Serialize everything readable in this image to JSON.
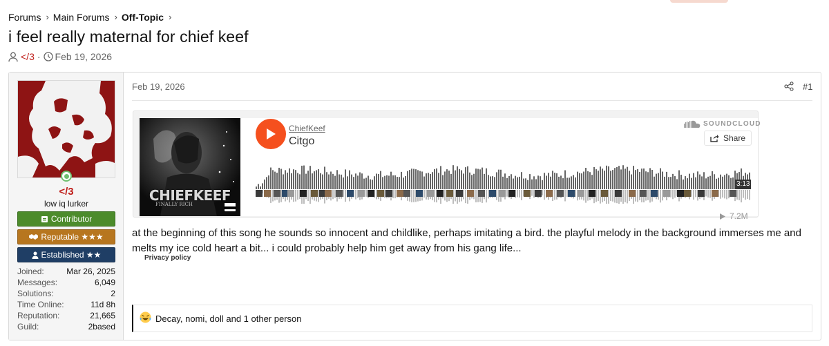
{
  "breadcrumb": {
    "items": [
      "Forums",
      "Main Forums",
      "Off-Topic"
    ]
  },
  "thread": {
    "title": "i feel really maternal for chief keef",
    "author": "</3",
    "separator": "·",
    "date": "Feb 19, 2026"
  },
  "user": {
    "name": "</3",
    "title": "low iq lurker",
    "banners": [
      "Contributor",
      "Reputable ★★★",
      "Established ★★"
    ],
    "stats": [
      {
        "label": "Joined:",
        "value": "Mar 26, 2025"
      },
      {
        "label": "Messages:",
        "value": "6,049"
      },
      {
        "label": "Solutions:",
        "value": "2"
      },
      {
        "label": "Time Online:",
        "value": "11d 8h"
      },
      {
        "label": "Reputation:",
        "value": "21,665"
      },
      {
        "label": "Guild:",
        "value": "2based"
      }
    ]
  },
  "post": {
    "date": "Feb 19, 2026",
    "number": "#1",
    "body": "at the beginning of this song he sounds so innocent and childlike, perhaps imitating a bird. the playful melody in the background immerses me and melts my ice cold heart a bit... i could probably help him get away from his gang life...",
    "reactions": "Decay, nomi, doll and 1 other person"
  },
  "embed": {
    "artist": "ChiefKeef",
    "track": "Citgo",
    "brand": "SOUNDCLOUD",
    "share_label": "Share",
    "duration": "3:13",
    "plays": "7.2M",
    "artwork_text": "CHIEFKEEF",
    "artwork_subtext": "FINALLY RICH",
    "privacy_label": "Privacy policy"
  },
  "colors": {
    "accent_orange": "#f5501e",
    "username_red": "#c0201c",
    "contributor_green": "#4c8b2b",
    "reputable_gold": "#b7761f",
    "established_navy": "#1f3e65"
  }
}
